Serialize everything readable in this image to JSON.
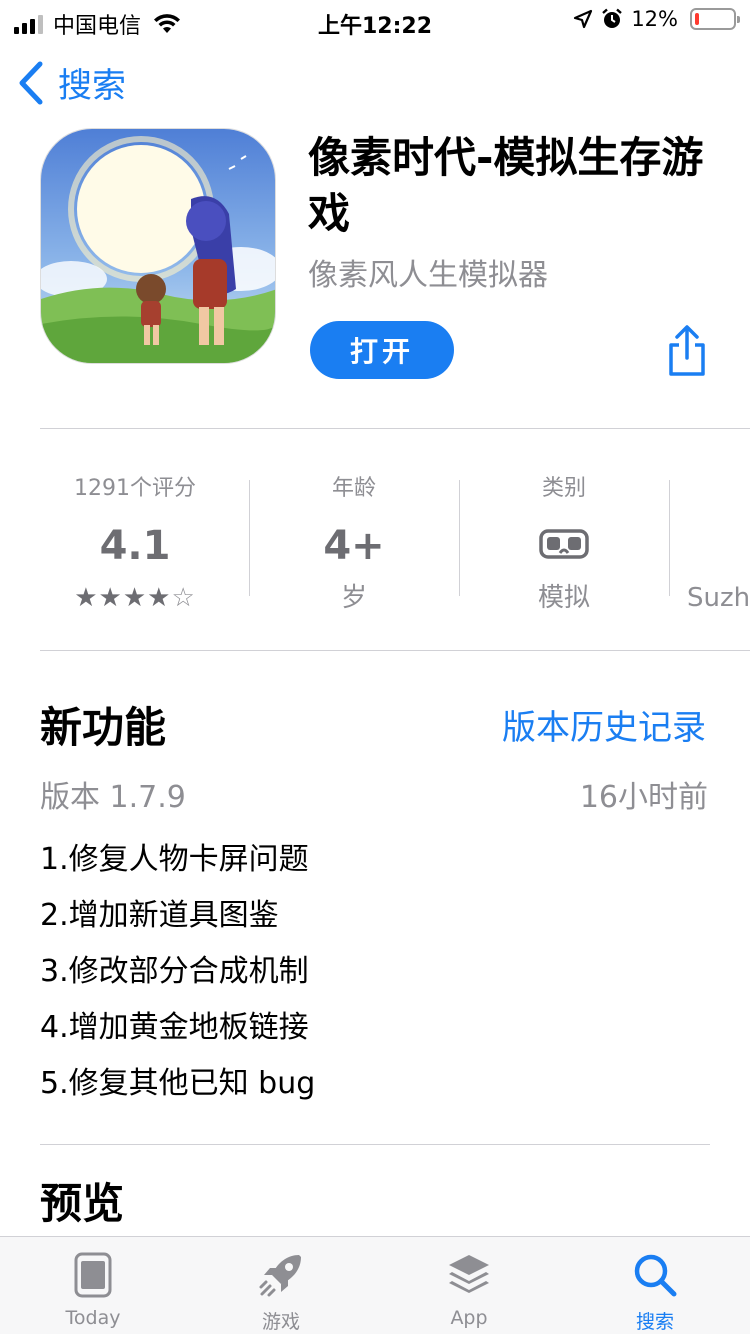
{
  "status_bar": {
    "carrier": "中国电信",
    "time": "上午12:22",
    "battery_percent_text": "12%",
    "battery_level": 0.12
  },
  "nav": {
    "back_label": "搜索"
  },
  "app": {
    "title": "像素时代-模拟生存游戏",
    "subtitle": "像素风人生模拟器",
    "open_label": "打开"
  },
  "info": {
    "ratings_label": "1291个评分",
    "rating_value": "4.1",
    "stars_filled": "★★★★",
    "stars_empty": "☆",
    "age_label": "年龄",
    "age_value": "4+",
    "age_unit": "岁",
    "category_label": "类别",
    "category_value": "模拟",
    "developer_partial": "Suzh"
  },
  "whats_new": {
    "title": "新功能",
    "history_link": "版本历史记录",
    "version": "版本 1.7.9",
    "time_ago": "16小时前",
    "notes": [
      "1.修复人物卡屏问题",
      "2.增加新道具图鉴",
      "3.修改部分合成机制",
      "4.增加黄金地板链接",
      "5.修复其他已知 bug"
    ]
  },
  "preview": {
    "title": "预览"
  },
  "tab_bar": {
    "tabs": [
      {
        "label": "Today",
        "icon": "today-icon"
      },
      {
        "label": "游戏",
        "icon": "rocket-icon"
      },
      {
        "label": "App",
        "icon": "layers-icon"
      },
      {
        "label": "搜索",
        "icon": "search-icon"
      }
    ],
    "active_index": 3
  },
  "colors": {
    "accent": "#1a7ef2",
    "secondary_text": "#8e8e93",
    "battery_low": "#ff3b30"
  }
}
